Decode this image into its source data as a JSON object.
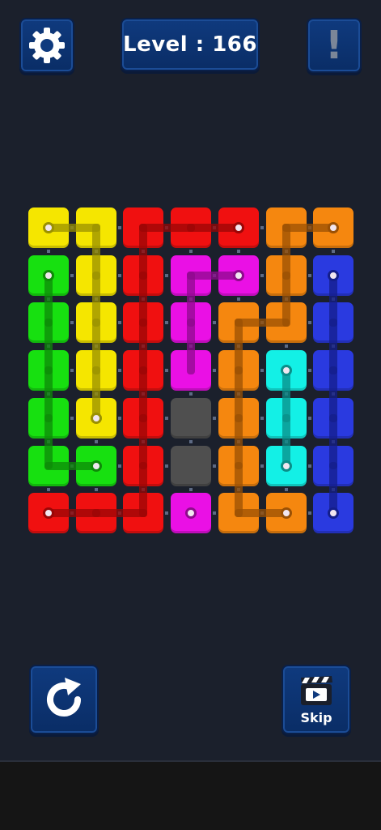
{
  "header": {
    "settings_icon": "gear-icon",
    "level_text": "Level : 166",
    "hint_icon": "exclamation-icon",
    "hint_glyph": "!"
  },
  "footer": {
    "restart_icon": "restart-arrow-icon",
    "skip_icon": "clapperboard-play-icon",
    "skip_label": "Skip"
  },
  "colors": {
    "yellow": "#f5e600",
    "red": "#f01010",
    "orange": "#f5870f",
    "green": "#17e010",
    "magenta": "#ea10e5",
    "blue": "#2a3ae0",
    "cyan": "#13f0e6",
    "gray": "#4f4f4f"
  },
  "grid": {
    "rows": 7,
    "cols": 7,
    "cells": [
      [
        "yellow",
        "yellow",
        "red",
        "red",
        "red",
        "orange",
        "orange"
      ],
      [
        "green",
        "yellow",
        "red",
        "magenta",
        "magenta",
        "orange",
        "blue"
      ],
      [
        "green",
        "yellow",
        "red",
        "magenta",
        "orange",
        "orange",
        "blue"
      ],
      [
        "green",
        "yellow",
        "red",
        "magenta",
        "orange",
        "cyan",
        "blue"
      ],
      [
        "green",
        "yellow",
        "red",
        "gray",
        "orange",
        "cyan",
        "blue"
      ],
      [
        "green",
        "green",
        "red",
        "gray",
        "orange",
        "cyan",
        "blue"
      ],
      [
        "red",
        "red",
        "red",
        "magenta",
        "orange",
        "orange",
        "blue"
      ]
    ],
    "endpoints": [
      {
        "color": "yellow",
        "cells": [
          [
            0,
            0
          ],
          [
            4,
            1
          ]
        ]
      },
      {
        "color": "red",
        "cells": [
          [
            0,
            4
          ],
          [
            6,
            0
          ]
        ]
      },
      {
        "color": "orange",
        "cells": [
          [
            0,
            6
          ],
          [
            6,
            5
          ]
        ]
      },
      {
        "color": "green",
        "cells": [
          [
            1,
            0
          ],
          [
            5,
            1
          ]
        ]
      },
      {
        "color": "magenta",
        "cells": [
          [
            1,
            4
          ],
          [
            6,
            3
          ]
        ]
      },
      {
        "color": "blue",
        "cells": [
          [
            1,
            6
          ],
          [
            6,
            6
          ]
        ]
      },
      {
        "color": "cyan",
        "cells": [
          [
            3,
            5
          ],
          [
            5,
            5
          ]
        ]
      }
    ],
    "paths": [
      {
        "color": "yellow",
        "cells": [
          [
            0,
            0
          ],
          [
            0,
            1
          ],
          [
            1,
            1
          ],
          [
            2,
            1
          ],
          [
            3,
            1
          ],
          [
            4,
            1
          ]
        ]
      },
      {
        "color": "red",
        "cells": [
          [
            6,
            0
          ],
          [
            6,
            1
          ],
          [
            6,
            2
          ],
          [
            5,
            2
          ],
          [
            4,
            2
          ],
          [
            3,
            2
          ],
          [
            2,
            2
          ],
          [
            1,
            2
          ],
          [
            0,
            2
          ],
          [
            0,
            3
          ],
          [
            0,
            4
          ]
        ]
      },
      {
        "color": "orange",
        "cells": [
          [
            0,
            6
          ],
          [
            0,
            5
          ],
          [
            1,
            5
          ],
          [
            2,
            5
          ],
          [
            2,
            4
          ],
          [
            3,
            4
          ],
          [
            4,
            4
          ],
          [
            5,
            4
          ],
          [
            6,
            4
          ],
          [
            6,
            5
          ]
        ]
      },
      {
        "color": "green",
        "cells": [
          [
            1,
            0
          ],
          [
            2,
            0
          ],
          [
            3,
            0
          ],
          [
            4,
            0
          ],
          [
            5,
            0
          ],
          [
            5,
            1
          ]
        ]
      },
      {
        "color": "magenta",
        "cells": [
          [
            1,
            4
          ],
          [
            1,
            3
          ],
          [
            2,
            3
          ],
          [
            3,
            3
          ]
        ]
      },
      {
        "color": "blue",
        "cells": [
          [
            1,
            6
          ],
          [
            2,
            6
          ],
          [
            3,
            6
          ],
          [
            4,
            6
          ],
          [
            5,
            6
          ],
          [
            6,
            6
          ]
        ]
      },
      {
        "color": "cyan",
        "cells": [
          [
            3,
            5
          ],
          [
            4,
            5
          ],
          [
            5,
            5
          ]
        ]
      }
    ]
  }
}
